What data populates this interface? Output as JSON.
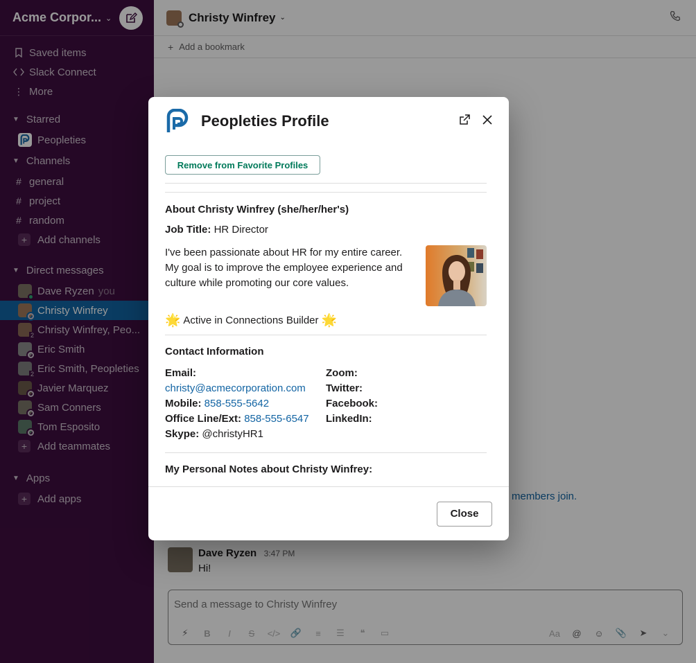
{
  "workspace": {
    "name": "Acme Corpor...",
    "compose_icon": "compose-icon"
  },
  "sidebar": {
    "top_items": [
      {
        "label": "Saved items",
        "icon": "bookmark-icon"
      },
      {
        "label": "Slack Connect",
        "icon": "slack-connect-icon"
      },
      {
        "label": "More",
        "icon": "more-icon"
      }
    ],
    "starred_title": "Starred",
    "starred_items": [
      {
        "label": "Peopleties"
      }
    ],
    "channels_title": "Channels",
    "channels": [
      "general",
      "project",
      "random"
    ],
    "add_channels": "Add channels",
    "dm_title": "Direct messages",
    "dms": [
      {
        "label": "Dave Ryzen",
        "suffix": "you"
      },
      {
        "label": "Christy Winfrey"
      },
      {
        "label": "Christy Winfrey, Peo...",
        "badge": "2"
      },
      {
        "label": "Eric Smith"
      },
      {
        "label": "Eric Smith, Peopleties",
        "badge": "2"
      },
      {
        "label": "Javier Marquez"
      },
      {
        "label": "Sam Conners"
      },
      {
        "label": "Tom Esposito"
      }
    ],
    "add_teammates": "Add teammates",
    "apps_title": "Apps",
    "add_apps": "Add apps"
  },
  "channel": {
    "title": "Christy Winfrey",
    "bookmark_label": "Add a bookmark",
    "join_text": "members join.",
    "message": {
      "author": "Dave Ryzen",
      "time": "3:47 PM",
      "text": "Hi!"
    },
    "composer_placeholder": "Send a message to Christy Winfrey",
    "composer_format_label": "Aa"
  },
  "modal": {
    "title": "Peopleties Profile",
    "remove_favorite_label": "Remove from Favorite Profiles",
    "about_title": "About Christy Winfrey (she/her/her's)",
    "job_title_label": "Job Title:",
    "job_title_value": "HR Director",
    "bio": "I've been passionate about HR for my entire career. My goal is to improve the employee experience and culture while promoting our core values.",
    "active_text": "Active in Connections Builder",
    "contact_title": "Contact Information",
    "email_label": "Email:",
    "email_value": "christy@acmecorporation.com",
    "mobile_label": "Mobile:",
    "mobile_value": "858-555-5642",
    "office_label": "Office Line/Ext:",
    "office_value": "858-555-6547",
    "skype_label": "Skype:",
    "skype_value": "@christyHR1",
    "zoom_label": "Zoom:",
    "twitter_label": "Twitter:",
    "facebook_label": "Facebook:",
    "linkedin_label": "LinkedIn:",
    "notes_title": "My Personal Notes about Christy Winfrey:",
    "close_label": "Close"
  },
  "colors": {
    "sidebar_bg": "#3f0e40",
    "active_item": "#1164a3",
    "link": "#1264a3",
    "favorite_green": "#007a5a",
    "brand_blue": "#1a6aa8"
  }
}
